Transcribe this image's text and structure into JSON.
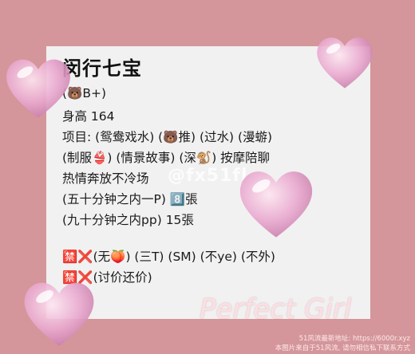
{
  "title": "闵行七宝",
  "lines": [
    "(🐻B+)",
    "身高 164",
    "项目: (鸳鸯戏水) (🐻推) (过水) (漫蝣)",
    "(制服👙) (情景故事) (深🐒) 按摩陪聊",
    "热情奔放不冷场",
    "(五十分钟之内一P) 8️⃣張",
    "(九十分钟之内pp) 15張",
    "🈲❌(无🍑) (三T) (SM) (不ye) (不外)",
    "🈲❌(讨价还价)"
  ],
  "watermark": "@fx51fl",
  "perfect_girl": "Perfect Girl",
  "footer": {
    "line1": "51风流最新地址: https://6000r.xyz",
    "line2": "本图片来自于51风流, 请勿相信私下联系方式"
  }
}
